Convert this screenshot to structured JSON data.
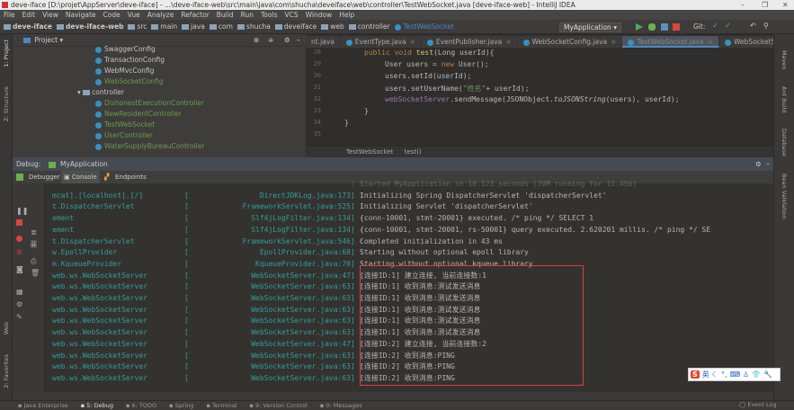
{
  "window": {
    "title": "deve-iface [D:\\projet\\AppServer\\deve-iface] - ...\\deve-iface-web\\src\\main\\java\\com\\shucha\\deveiface\\web\\controller\\TestWebSocket.java [deve-iface-web] - IntelliJ IDEA",
    "minimize": "–",
    "maximize": "❐",
    "close": "✕"
  },
  "menu": [
    "File",
    "Edit",
    "View",
    "Navigate",
    "Code",
    "Vue",
    "Analyze",
    "Refactor",
    "Build",
    "Run",
    "Tools",
    "VCS",
    "Window",
    "Help"
  ],
  "breadcrumb": [
    "deve-iface",
    "deve-iface-web",
    "src",
    "main",
    "java",
    "com",
    "shucha",
    "deveiface",
    "web",
    "controller",
    "TestWebSocket"
  ],
  "toolbar": {
    "run_config": "MyApplication ▾",
    "git_label": "Git:"
  },
  "left_tools": {
    "project": "1: Project",
    "structure": "Z: Structure",
    "web": "Web",
    "favorites": "2: Favorites"
  },
  "right_tools": {
    "maven": "Maven",
    "ant": "Ant Build",
    "database": "Database",
    "bean": "Bean Validation"
  },
  "project": {
    "header": "Project ▾",
    "items": [
      {
        "label": "SwaggerConfig",
        "kind": "class",
        "color": "normal"
      },
      {
        "label": "TransactionConfig",
        "kind": "class",
        "color": "normal"
      },
      {
        "label": "WebMvcConfig",
        "kind": "class",
        "color": "normal"
      },
      {
        "label": "WebSocketConfig",
        "kind": "class",
        "color": "green"
      },
      {
        "label": "controller",
        "kind": "folder",
        "color": "normal"
      },
      {
        "label": "DishonestExecutionController",
        "kind": "class",
        "color": "green"
      },
      {
        "label": "NewResidentController",
        "kind": "class",
        "color": "green"
      },
      {
        "label": "TestWebSocket",
        "kind": "class",
        "color": "green"
      },
      {
        "label": "UserController",
        "kind": "class",
        "color": "green"
      },
      {
        "label": "WaterSupplyBureauController",
        "kind": "class",
        "color": "green"
      }
    ]
  },
  "editor": {
    "tabs": [
      {
        "label": "nt.java"
      },
      {
        "label": "EventType.java"
      },
      {
        "label": "EventPublisher.java"
      },
      {
        "label": "WebSocketConfig.java"
      },
      {
        "label": "TestWebSocket.java",
        "active": true
      },
      {
        "label": "WebSocketServer.java"
      }
    ],
    "line_numbers": [
      "28",
      "29",
      "30",
      "31",
      "32",
      "33",
      "34",
      "35"
    ],
    "code": {
      "l1a": "public void ",
      "l1b": "test",
      "l1c": "(Long userId){",
      "l2a": "User users = ",
      "l2b": "new ",
      "l2c": "User();",
      "l3": "users.setId(userId);",
      "l4a": "users.setUserName(",
      "l4b": "\"姓名\"",
      "l4c": "+ userId);",
      "l5a": "webSocketServer",
      ".l5b": "",
      "l5b": ".sendMessage(JSONObject.",
      "l5c": "toJSONString",
      "l5d": "(users), userId);",
      "l6": "}",
      "l7": "}"
    },
    "crumbs": [
      "TestWebSocket",
      "test()"
    ]
  },
  "debug": {
    "label": "Debug:",
    "config": "MyApplication",
    "tabs": [
      "Debugger",
      "Console",
      "Endpoints"
    ]
  },
  "console": {
    "rows": [
      {
        "logger": "",
        "loc": "",
        "msg": "Started MyApplication in 10.123 seconds (JVM running for 11.456)"
      },
      {
        "logger": "mcat].[localhost].[/]",
        "loc": "DirectJDKLog.java:173",
        "msg": "Initializing Spring DispatcherServlet 'dispatcherServlet'"
      },
      {
        "logger": "t.DispatcherServlet",
        "loc": "FrameworkServlet.java:525",
        "msg": "Initializing Servlet 'dispatcherServlet'"
      },
      {
        "logger": "ement",
        "loc": "Slf4jLogFilter.java:134",
        "msg": "{conn-10001, stmt-20001} executed. /* ping */ SELECT 1"
      },
      {
        "logger": "ement",
        "loc": "Slf4jLogFilter.java:134",
        "msg": "{conn-10001, stmt-20001, rs-50001} query executed. 2.620201 millis. /* ping */ SE"
      },
      {
        "logger": "t.DispatcherServlet",
        "loc": "FrameworkServlet.java:546",
        "msg": "Completed initialization in 43 ms"
      },
      {
        "logger": "w.EpollProvider",
        "loc": "EpollProvider.java:68",
        "msg": "Starting without optional epoll library"
      },
      {
        "logger": "m.KqueueProvider",
        "loc": "KqueueProvider.java:70",
        "msg": "Starting without optional kqueue library"
      },
      {
        "logger": "web.ws.WebSocketServer",
        "loc": "WebSocketServer.java:47",
        "msg": "[连接ID:1] 建立连接, 当前连接数:1"
      },
      {
        "logger": "web.ws.WebSocketServer",
        "loc": "WebSocketServer.java:63",
        "msg": "[连接ID:1] 收到消息:测试发送消息"
      },
      {
        "logger": "web.ws.WebSocketServer",
        "loc": "WebSocketServer.java:63",
        "msg": "[连接ID:1] 收到消息:测试发送消息"
      },
      {
        "logger": "web.ws.WebSocketServer",
        "loc": "WebSocketServer.java:63",
        "msg": "[连接ID:1] 收到消息:测试发送消息"
      },
      {
        "logger": "web.ws.WebSocketServer",
        "loc": "WebSocketServer.java:63",
        "msg": "[连接ID:1] 收到消息:测试发送消息"
      },
      {
        "logger": "web.ws.WebSocketServer",
        "loc": "WebSocketServer.java:63",
        "msg": "[连接ID:1] 收到消息:测试发送消息"
      },
      {
        "logger": "web.ws.WebSocketServer",
        "loc": "WebSocketServer.java:47",
        "msg": "[连接ID:2] 建立连接, 当前连接数:2"
      },
      {
        "logger": "web.ws.WebSocketServer",
        "loc": "WebSocketServer.java:63",
        "msg": "[连接ID:2] 收到消息:PING"
      },
      {
        "logger": "web.ws.WebSocketServer",
        "loc": "WebSocketServer.java:63",
        "msg": "[连接ID:2] 收到消息:PING"
      },
      {
        "logger": "web.ws.WebSocketServer",
        "loc": "WebSocketServer.java:63",
        "msg": "[连接ID:2] 收到消息:PING"
      }
    ]
  },
  "ime": {
    "logo": "S",
    "mode": "英"
  },
  "statusbar": [
    "Java Enterprise",
    "5: Debug",
    "6: TODO",
    "Spring",
    "Terminal",
    "9: Version Control",
    "0: Messages"
  ],
  "event_log": "Event Log",
  "colors": {
    "highlight_box": "#e03c3c",
    "logger": "#2e9f9f",
    "accent": "#4a88c7"
  }
}
